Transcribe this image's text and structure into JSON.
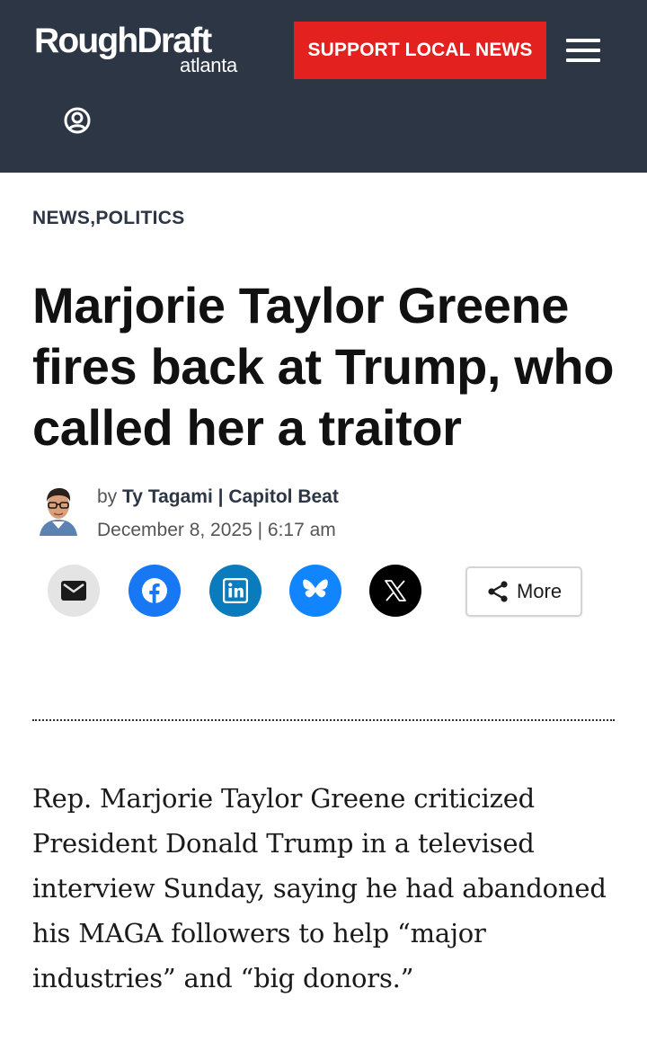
{
  "header": {
    "logo_main": "RoughDraft",
    "logo_sub": "atlanta",
    "support_label": "SUPPORT LOCAL NEWS",
    "menu_icon": "hamburger-menu-icon",
    "account_icon": "user-account-icon",
    "background_color": "#2c3644",
    "accent_color": "#e3221f"
  },
  "article": {
    "categories": "NEWS,POLITICS",
    "headline": "Marjorie Taylor Greene fires back at Trump, who called her a traitor",
    "byline_prefix": "by",
    "author": "Ty Tagami | Capitol Beat",
    "date": "December 8, 2025 | 6:17 am",
    "body": "Rep. Marjorie Taylor Greene criticized President Donald Trump in a televised interview Sunday, saying he had abandoned his MAGA followers to help “major industries” and “big donors.”"
  },
  "share": {
    "buttons": [
      {
        "icon": "email-icon",
        "color": "#e4e4e4"
      },
      {
        "icon": "facebook-icon",
        "color": "#1877f2"
      },
      {
        "icon": "linkedin-icon",
        "color": "#0a7bbd"
      },
      {
        "icon": "bluesky-icon",
        "color": "#1185fe"
      },
      {
        "icon": "x-icon",
        "color": "#000000"
      }
    ],
    "more_label": "More",
    "more_icon": "share-icon"
  }
}
